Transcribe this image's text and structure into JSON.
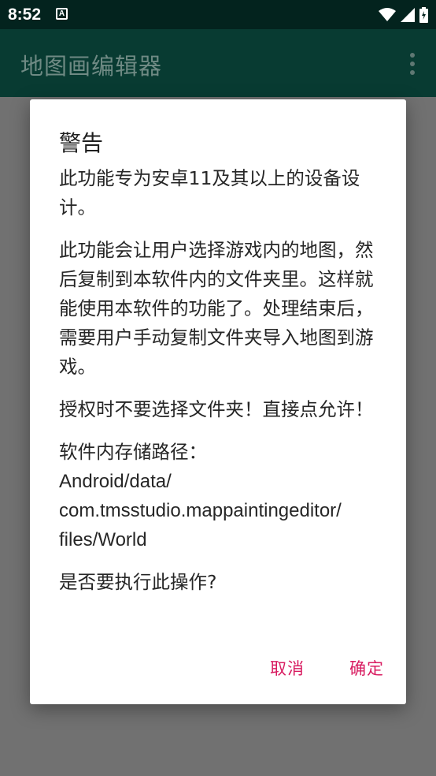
{
  "status_bar": {
    "time": "8:52",
    "notification_icon": "A"
  },
  "app_bar": {
    "title": "地图画编辑器",
    "menu_icon": "more-vert-icon"
  },
  "dialog": {
    "title": "警告",
    "paragraphs": [
      "此功能专为安卓11及其以上的设备设计。",
      "此功能会让用户选择游戏内的地图，然后复制到本软件内的文件夹里。这样就能使用本软件的功能了。处理结束后，需要用户手动复制文件夹导入地图到游戏。",
      "授权时不要选择文件夹！直接点允许！"
    ],
    "path_label": "软件内存储路径：",
    "path_lines": [
      "Android/data/",
      "com.tmsstudio.mappaintingeditor/",
      "files/World"
    ],
    "question": "是否要执行此操作?",
    "cancel_label": "取消",
    "confirm_label": "确定"
  },
  "colors": {
    "status_bar": "#03231e",
    "app_bar": "#083b32",
    "scrim": "#717171",
    "accent": "#d81b60"
  }
}
